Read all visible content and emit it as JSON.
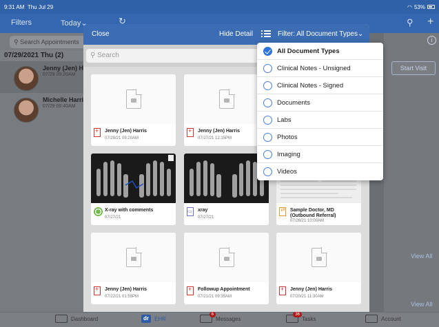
{
  "status": {
    "time": "9:31 AM",
    "date": "Thu Jul 29",
    "battery": "53%"
  },
  "nav": {
    "filters": "Filters",
    "today": "Today⌄",
    "refresh": "↻",
    "search": "⚲",
    "plus": "+"
  },
  "left": {
    "search_placeholder": "Search Appointments",
    "date_header": "07/29/2021 Thu (2)",
    "appointments": [
      {
        "name": "Jenny (Jen) Harris",
        "time": "07/29 09:20AM"
      },
      {
        "name": "Michelle Harris",
        "time": "07/29 09:40AM"
      }
    ]
  },
  "right": {
    "info": "i",
    "start_visit": "Start Visit",
    "view_all_1": "View All",
    "view_all_2": "View All"
  },
  "modal": {
    "close": "Close",
    "hide_detail": "Hide Detail",
    "filter_label": "Filter: All Document Types⌄",
    "search_placeholder": "Search",
    "cards": [
      {
        "title": "Jenny (Jen) Harris",
        "date": "07/29/21 09:20AM"
      },
      {
        "title": "Jenny (Jen) Harris",
        "date": "07/27/21 12:15PM"
      },
      {
        "title": "X-ray with comments",
        "date": "07/27/21"
      },
      {
        "title": "xray",
        "date": "07/27/21"
      },
      {
        "title": "Sample Doctor, MD (Outbound Referral)",
        "date": "07/26/21 10:00AM"
      },
      {
        "title": "Jenny (Jen) Harris",
        "date": "07/22/21 01:55PM"
      },
      {
        "title": "Followup Appointment",
        "date": "07/21/21 09:35AM"
      },
      {
        "title": "Jenny (Jen) Harris",
        "date": "07/20/21 11:30AM"
      }
    ]
  },
  "dropdown": {
    "options": [
      {
        "label": "All Document Types",
        "selected": true
      },
      {
        "label": "Clinical Notes - Unsigned",
        "selected": false
      },
      {
        "label": "Clinical Notes - Signed",
        "selected": false
      },
      {
        "label": "Documents",
        "selected": false
      },
      {
        "label": "Labs",
        "selected": false
      },
      {
        "label": "Photos",
        "selected": false
      },
      {
        "label": "Imaging",
        "selected": false
      },
      {
        "label": "Videos",
        "selected": false
      }
    ]
  },
  "tabbar": {
    "dashboard": "Dashboard",
    "ehr_icon": "dr",
    "ehr": "EHR",
    "messages": "Messages",
    "messages_badge": "6",
    "tasks": "Tasks",
    "tasks_badge": "36",
    "account": "Account"
  }
}
